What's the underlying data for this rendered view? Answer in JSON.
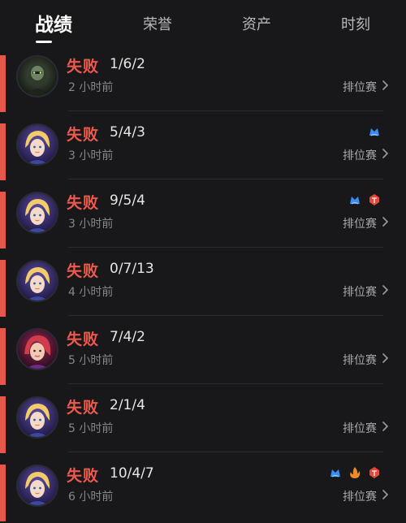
{
  "tabs": [
    {
      "label": "战绩",
      "active": true
    },
    {
      "label": "荣誉",
      "active": false
    },
    {
      "label": "资产",
      "active": false
    },
    {
      "label": "时刻",
      "active": false
    }
  ],
  "colors": {
    "background": "#18181a",
    "loss": "#ee5a4c",
    "badge_blue": "#3d8cf0",
    "badge_orange": "#f08a25",
    "badge_red": "#e04a3c"
  },
  "matches": [
    {
      "result": "失败",
      "kda": "1/6/2",
      "time": "2 小时前",
      "mode": "排位赛",
      "hero_icon": "hero-portrait-dark",
      "badges": []
    },
    {
      "result": "失败",
      "kda": "5/4/3",
      "time": "3 小时前",
      "mode": "排位赛",
      "hero_icon": "hero-portrait-blonde",
      "badges": [
        "mvp-blue-icon"
      ]
    },
    {
      "result": "失败",
      "kda": "9/5/4",
      "time": "3 小时前",
      "mode": "排位赛",
      "hero_icon": "hero-portrait-blonde",
      "badges": [
        "mvp-blue-icon",
        "kill-red-icon"
      ]
    },
    {
      "result": "失败",
      "kda": "0/7/13",
      "time": "4 小时前",
      "mode": "排位赛",
      "hero_icon": "hero-portrait-blonde",
      "badges": []
    },
    {
      "result": "失败",
      "kda": "7/4/2",
      "time": "5 小时前",
      "mode": "排位赛",
      "hero_icon": "hero-portrait-redhair",
      "badges": []
    },
    {
      "result": "失败",
      "kda": "2/1/4",
      "time": "5 小时前",
      "mode": "排位赛",
      "hero_icon": "hero-portrait-blonde",
      "badges": []
    },
    {
      "result": "失败",
      "kda": "10/4/7",
      "time": "6 小时前",
      "mode": "排位赛",
      "hero_icon": "hero-portrait-blonde",
      "badges": [
        "mvp-blue-icon",
        "fire-orange-icon",
        "kill-red-icon"
      ]
    }
  ]
}
